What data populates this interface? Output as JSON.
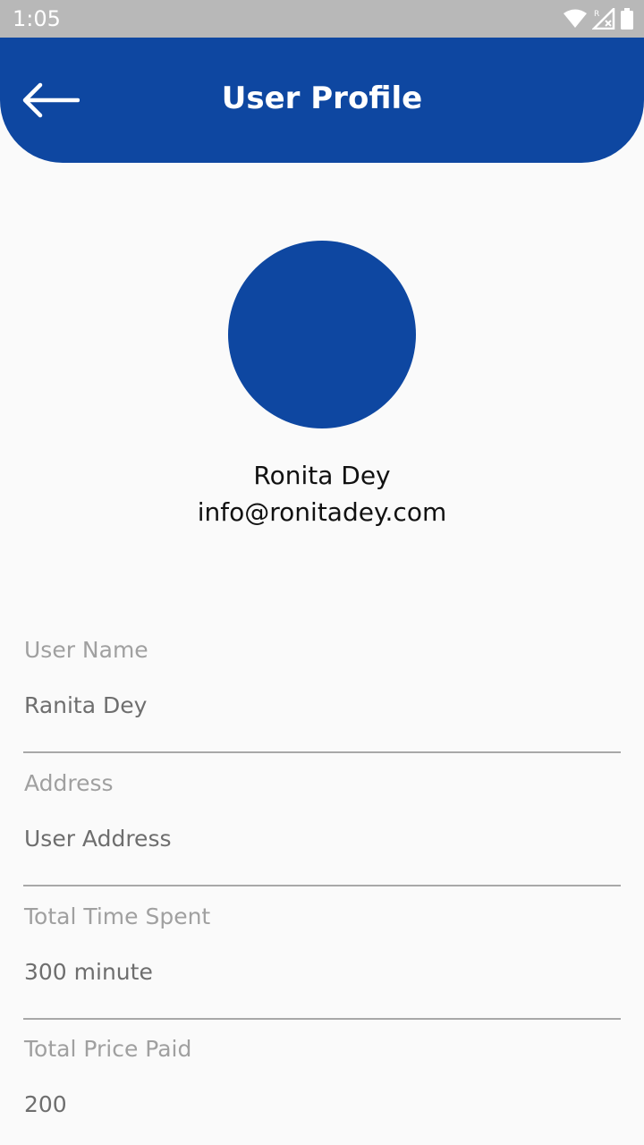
{
  "status_bar": {
    "time": "1:05",
    "icons": [
      "wifi-icon",
      "signal-roaming-icon",
      "battery-icon"
    ]
  },
  "app_bar": {
    "title": "User Profile",
    "back_icon": "arrow-left-icon",
    "color": "#0e47a1"
  },
  "profile": {
    "name": "Ronita Dey",
    "email": "info@ronitadey.com",
    "avatar_color": "#0e47a1"
  },
  "fields": [
    {
      "label": "User Name",
      "value": "Ranita Dey"
    },
    {
      "label": "Address",
      "value": "User Address"
    },
    {
      "label": "Total Time Spent",
      "value": "300 minute"
    },
    {
      "label": "Total Price Paid",
      "value": "200"
    }
  ]
}
